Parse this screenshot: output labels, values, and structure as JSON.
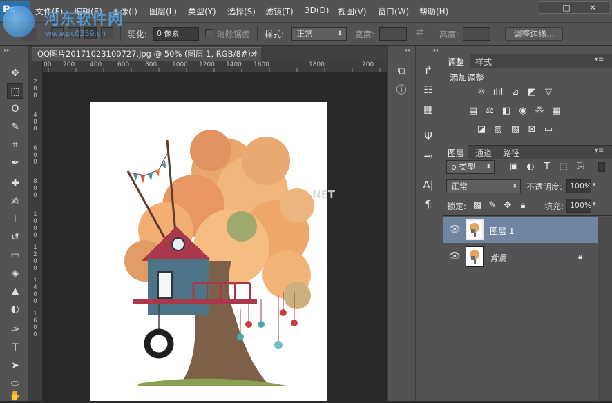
{
  "app": {
    "logo": "Ps"
  },
  "menu": [
    "文件(F)",
    "编辑(E)",
    "图像(I)",
    "图层(L)",
    "类型(Y)",
    "选择(S)",
    "滤镜(T)",
    "3D(D)",
    "视图(V)",
    "窗口(W)",
    "帮助(H)"
  ],
  "window_controls": {
    "minimize": "—",
    "maximize": "□",
    "close": "✕"
  },
  "watermark": {
    "title": "河东软件网",
    "url": "www.pc0359.cn"
  },
  "options": {
    "feather_label": "羽化:",
    "feather_value": "0 像素",
    "antialias_label": "消除锯齿",
    "style_label": "样式:",
    "style_value": "正常",
    "width_label": "宽度:",
    "height_label": "高度:",
    "refine_edge_label": "调整边缘..."
  },
  "document": {
    "tab_title": "QQ图片20171023100727.jpg @ 50% (图层 1, RGB/8#) *",
    "tab_close": "×",
    "ruler_h": [
      "00",
      "200",
      "400",
      "600",
      "800",
      "1000",
      "1200",
      "1400",
      "1600",
      "1800",
      "200"
    ],
    "ruler_v": [
      "2",
      "0",
      "0",
      "4",
      "0",
      "0",
      "6",
      "0",
      "0",
      "8",
      "0",
      "0",
      "1",
      "0",
      "0",
      "0",
      "1",
      "2",
      "0",
      "0",
      "1",
      "4",
      "0",
      "0",
      "1",
      "6",
      "0",
      "0"
    ],
    "canvas_watermark": "NET"
  },
  "adjustments": {
    "tabs": [
      "调整",
      "样式"
    ],
    "title": "添加调整"
  },
  "layers": {
    "tabs": [
      "图层",
      "通道",
      "路径"
    ],
    "filter_label": "ρ 类型",
    "blend_mode": "正常",
    "opacity_label": "不透明度:",
    "opacity_value": "100%",
    "lock_label": "锁定:",
    "fill_label": "填充:",
    "fill_value": "100%",
    "items": [
      {
        "name": "图层 1",
        "selected": true
      },
      {
        "name": "背景",
        "locked": true
      }
    ]
  },
  "colors": {
    "accent": "#2d6fa8",
    "layer_selected": "#6f85a0"
  }
}
